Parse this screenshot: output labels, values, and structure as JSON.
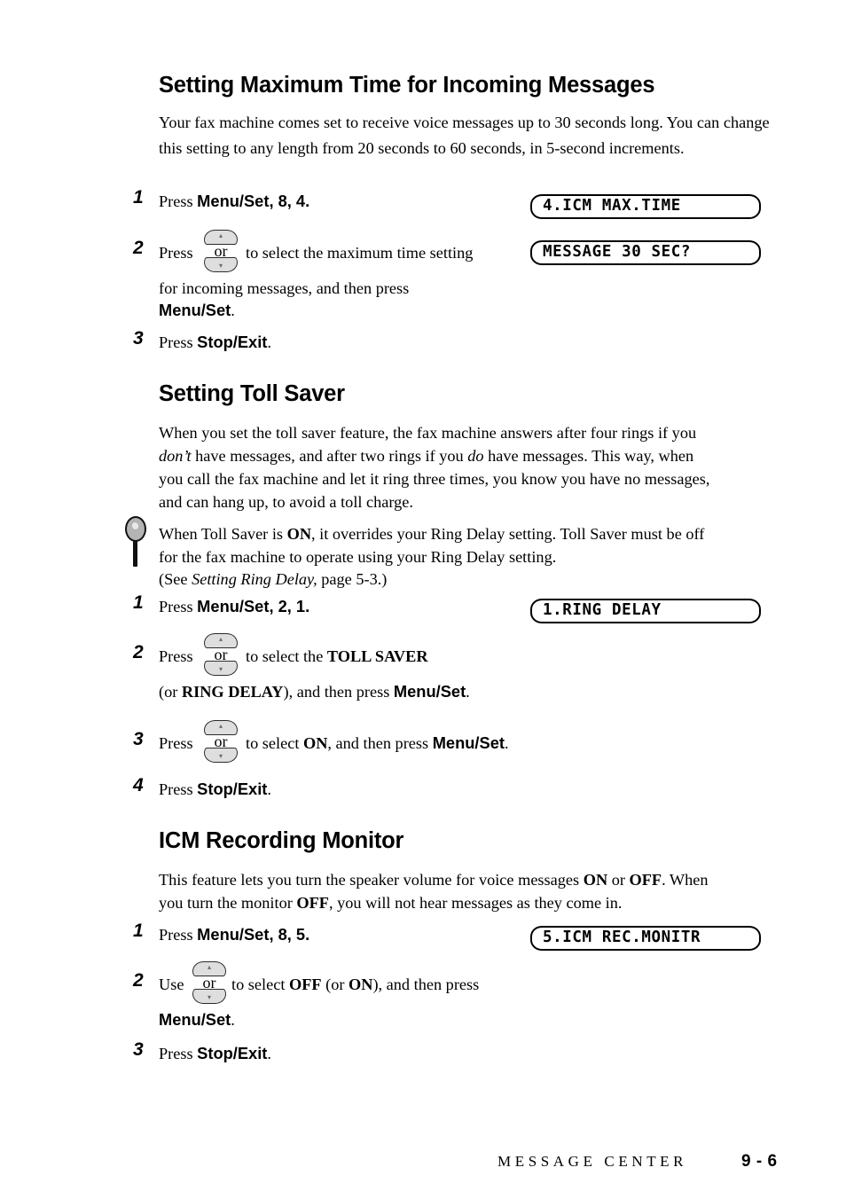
{
  "document": {
    "footer": {
      "chapter_title": "MESSAGE CENTER",
      "page_number": "9 - 6"
    }
  },
  "sections": [
    {
      "heading": "Setting Maximum Time for Incoming Messages",
      "intro": "Your fax machine comes set to receive voice messages up to 30 seconds long. You can change this setting to any length from 20 seconds to 60 seconds, in 5-second increments.",
      "steps": [
        {
          "number": "1",
          "text_pre": "Press ",
          "key": "Menu/Set",
          "text_post": ", 8, 4."
        },
        {
          "number": "2",
          "line1_pre": "Press ",
          "line1_post": " to select the maximum time setting",
          "line2": "for incoming messages, and then press",
          "line3_key": "Menu/Set",
          "line3_post": "."
        },
        {
          "number": "3",
          "text_pre": "Press ",
          "key": "Stop/Exit",
          "text_post": "."
        }
      ],
      "displays": [
        {
          "text": "4.ICM MAX.TIME"
        },
        {
          "text": "MESSAGE 30 SEC?"
        }
      ]
    },
    {
      "heading": "Setting Toll Saver",
      "intro_line1": "When you set the toll saver feature, the fax machine answers after four rings if you",
      "intro_line2_a": "don’t",
      "intro_line2_b": " have messages, and after two rings if you ",
      "intro_line2_c": "do",
      "intro_line2_d": " have messages. This way, when",
      "intro_line3": "you call the fax machine and let it ring three times, you know you have no messages,",
      "intro_line4": "and can hang up, to avoid a toll charge.",
      "note": {
        "line1_a": "When Toll Saver is ",
        "line1_b": "ON",
        "line1_c": ", it overrides your Ring Delay setting. Toll Saver must be off",
        "line2": "for the fax machine to operate using your Ring Delay setting.",
        "line3_a": "(See ",
        "line3_b": "Setting Ring Delay,",
        "line3_c": " page 5-3.)"
      },
      "steps": [
        {
          "number": "1",
          "text_pre": "Press ",
          "key": "Menu/Set",
          "text_post": ", 2, 1."
        },
        {
          "number": "2",
          "line1_pre": "Press ",
          "line1_mid": " to select the ",
          "line1_bold": "TOLL SAVER",
          "line2_a": "(or ",
          "line2_b": "RING DELAY",
          "line2_c": "), and then press  ",
          "line2_key": "Menu/Set",
          "line2_d": "."
        },
        {
          "number": "3",
          "line1_pre": "Press ",
          "line1_mid": " to select ",
          "line1_bold": "ON",
          "line1_post": ", and then press ",
          "line1_key": "Menu/Set",
          "line1_end": "."
        },
        {
          "number": "4",
          "text_pre": "Press ",
          "key": "Stop/Exit",
          "text_post": "."
        }
      ],
      "displays": [
        {
          "text": "1.RING DELAY"
        }
      ]
    },
    {
      "heading": "ICM Recording Monitor",
      "intro_line1_a": "This feature lets you turn the speaker volume for voice messages ",
      "intro_line1_b": "ON",
      "intro_line1_c": " or ",
      "intro_line1_d": "OFF",
      "intro_line1_e": ". When",
      "intro_line2_a": "you turn the monitor ",
      "intro_line2_b": "OFF",
      "intro_line2_c": ", you will not hear messages as they come in.",
      "steps": [
        {
          "number": "1",
          "text_pre": "Press ",
          "key": "Menu/Set",
          "text_post": ", 8, 5."
        },
        {
          "number": "2",
          "line1_pre": "Use ",
          "line1_mid": " to select ",
          "line1_bold1": "OFF",
          "line1_mid2": " (or ",
          "line1_bold2": "ON",
          "line1_post": "), and then press",
          "line2_key": "Menu/Set",
          "line2_post": "."
        },
        {
          "number": "3",
          "text_pre": "Press ",
          "key": "Stop/Exit",
          "text_post": "."
        }
      ],
      "displays": [
        {
          "text": "5.ICM REC.MONITR"
        }
      ]
    }
  ],
  "icons": {
    "updown_key": {
      "name": "updown-arrow-key-icon",
      "or_label": "or",
      "up_glyph": "▴",
      "down_glyph": "▾"
    },
    "note": {
      "name": "magnifier-note-icon"
    }
  }
}
